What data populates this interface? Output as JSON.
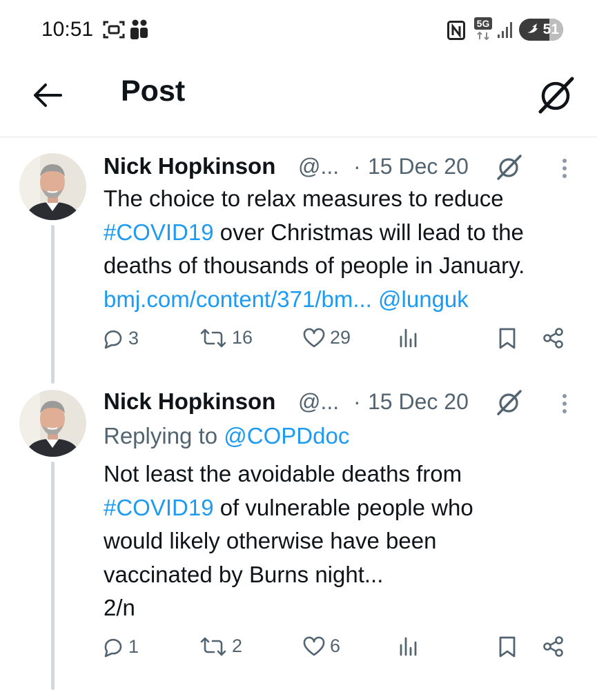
{
  "status_bar": {
    "time": "10:51",
    "network": "5G",
    "battery": "51",
    "icons": [
      "screenshot-icon",
      "teams-icon",
      "nfc-icon",
      "5g-icon",
      "signal-icon",
      "battery-icon"
    ]
  },
  "header": {
    "title": "Post",
    "back_icon": "back-arrow-icon",
    "grok_icon": "grok-icon"
  },
  "tweets": [
    {
      "author": "Nick Hopkinson",
      "handle": "@...",
      "separator": "·",
      "date": "15 Dec 20",
      "replying_label": "",
      "replying_handle": "",
      "body": {
        "line1": "The choice to relax measures to reduce",
        "hashtag": "#COVID19",
        "line2_rest": " over Christmas will lead to the",
        "line3": "deaths of thousands of people in January.",
        "url": "bmj.com/content/371/bm...",
        "mention": "@lunguk"
      },
      "stats": {
        "replies": "3",
        "reposts": "16",
        "likes": "29"
      }
    },
    {
      "author": "Nick Hopkinson",
      "handle": "@...",
      "separator": "·",
      "date": "15 Dec 20",
      "replying_label": "Replying to ",
      "replying_handle": "@COPDdoc",
      "body": {
        "line1": "Not least the avoidable deaths from",
        "hashtag": "#COVID19",
        "line2_rest": " of vulnerable people who",
        "line3": "would likely otherwise have been",
        "line4": "vaccinated by Burns night...",
        "line5": "2/n"
      },
      "stats": {
        "replies": "1",
        "reposts": "2",
        "likes": "6"
      }
    }
  ],
  "colors": {
    "link": "#1d9bf0",
    "muted": "#536471",
    "text": "#0f1419",
    "thread": "#cfd9de"
  }
}
